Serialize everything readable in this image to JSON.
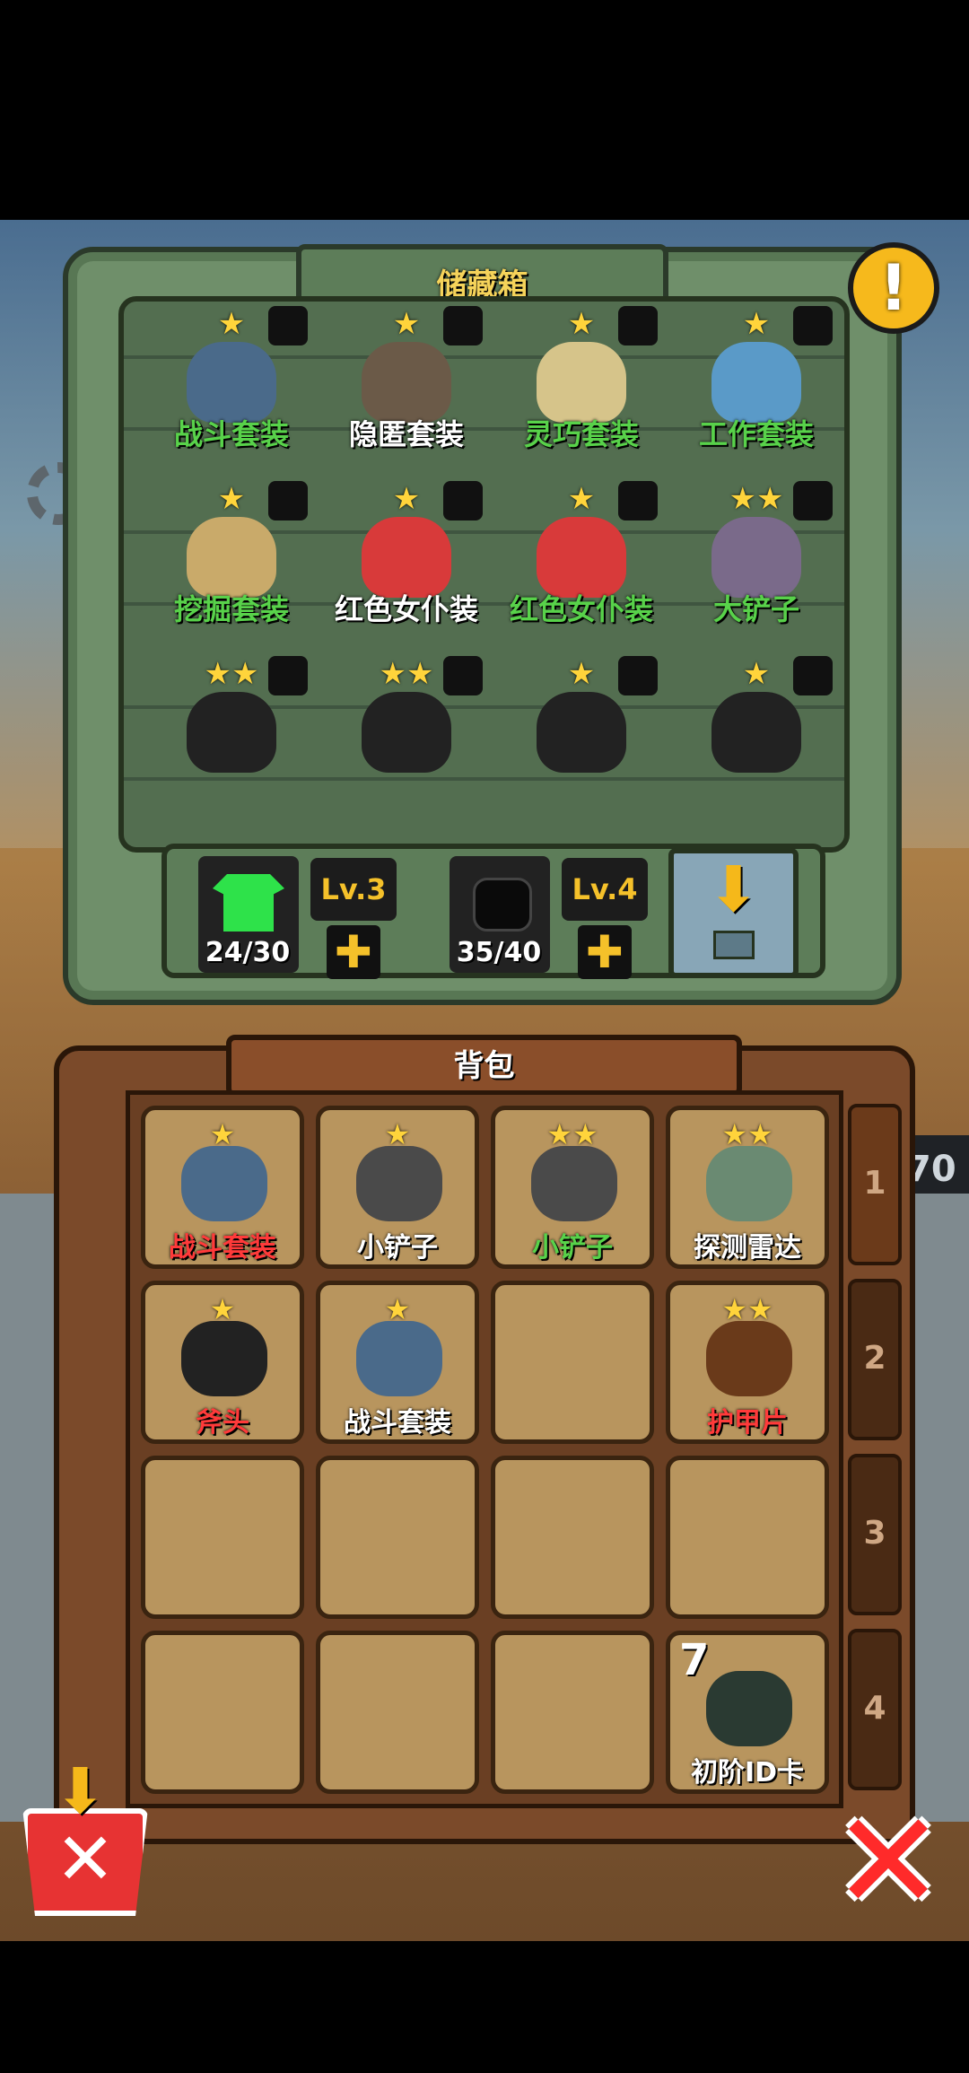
{
  "storage": {
    "title": "储藏箱",
    "alert_icon": "!",
    "items": [
      {
        "label": "战斗套装",
        "stars": "★",
        "color": "green",
        "icon": "combat-suit-icon",
        "tint": "#4a6a8a"
      },
      {
        "label": "隐匿套装",
        "stars": "★",
        "color": "white",
        "icon": "stealth-suit-icon",
        "tint": "#6b5a48"
      },
      {
        "label": "灵巧套装",
        "stars": "★",
        "color": "green",
        "icon": "agile-suit-icon",
        "tint": "#d6c48a"
      },
      {
        "label": "工作套装",
        "stars": "★",
        "color": "green",
        "icon": "work-suit-icon",
        "tint": "#5a9ac8"
      },
      {
        "label": "挖掘套装",
        "stars": "★",
        "color": "green",
        "icon": "digging-suit-icon",
        "tint": "#c9aa6a"
      },
      {
        "label": "红色女仆装",
        "stars": "★",
        "color": "white",
        "icon": "red-maid-outfit-icon",
        "tint": "#d83a3a"
      },
      {
        "label": "红色女仆装",
        "stars": "★",
        "color": "green",
        "icon": "red-maid-outfit-icon",
        "tint": "#d83a3a"
      },
      {
        "label": "大铲子",
        "stars": "★★",
        "color": "green",
        "icon": "big-shovel-icon",
        "tint": "#7a6a8a"
      },
      {
        "label": "",
        "stars": "★★",
        "color": "white",
        "icon": "slingshot-icon",
        "tint": "#222"
      },
      {
        "label": "",
        "stars": "★★",
        "color": "white",
        "icon": "slingshot-icon",
        "tint": "#222"
      },
      {
        "label": "",
        "stars": "★",
        "color": "white",
        "icon": "pistol-icon",
        "tint": "#222"
      },
      {
        "label": "",
        "stars": "★",
        "color": "white",
        "icon": "rocket-launcher-icon",
        "tint": "#222"
      }
    ],
    "outfit_capacity": "24/30",
    "outfit_level": "Lv.3",
    "bag_capacity": "35/40",
    "bag_level": "Lv.4",
    "plus_label": "✚",
    "store_arrow": "⬇"
  },
  "backpack": {
    "title": "背包",
    "cells": [
      {
        "label": "战斗套装",
        "stars": "★",
        "color": "red",
        "icon": "combat-suit-icon",
        "tint": "#4a6a8a",
        "qty": ""
      },
      {
        "label": "小铲子",
        "stars": "★",
        "color": "white",
        "icon": "small-shovel-icon",
        "tint": "#4a4a4a",
        "qty": ""
      },
      {
        "label": "小铲子",
        "stars": "★★",
        "color": "green",
        "icon": "small-shovel-icon",
        "tint": "#4a4a4a",
        "qty": ""
      },
      {
        "label": "探测雷达",
        "stars": "★★",
        "color": "white",
        "icon": "radar-detector-icon",
        "tint": "#6a8a72",
        "qty": ""
      },
      {
        "label": "斧头",
        "stars": "★",
        "color": "red",
        "icon": "axe-icon",
        "tint": "#222",
        "qty": ""
      },
      {
        "label": "战斗套装",
        "stars": "★",
        "color": "white",
        "icon": "combat-suit-icon",
        "tint": "#4a6a8a",
        "qty": ""
      },
      {
        "label": "",
        "stars": "",
        "color": "white",
        "icon": "",
        "tint": "transparent",
        "qty": ""
      },
      {
        "label": "护甲片",
        "stars": "★★",
        "color": "red",
        "icon": "armor-plate-icon",
        "tint": "#6a3a1a",
        "qty": ""
      },
      {
        "label": "",
        "stars": "",
        "color": "white",
        "icon": "",
        "tint": "transparent",
        "qty": ""
      },
      {
        "label": "",
        "stars": "",
        "color": "white",
        "icon": "",
        "tint": "transparent",
        "qty": ""
      },
      {
        "label": "",
        "stars": "",
        "color": "white",
        "icon": "",
        "tint": "transparent",
        "qty": ""
      },
      {
        "label": "",
        "stars": "",
        "color": "white",
        "icon": "",
        "tint": "transparent",
        "qty": ""
      },
      {
        "label": "",
        "stars": "",
        "color": "white",
        "icon": "",
        "tint": "transparent",
        "qty": ""
      },
      {
        "label": "",
        "stars": "",
        "color": "white",
        "icon": "",
        "tint": "transparent",
        "qty": ""
      },
      {
        "label": "",
        "stars": "",
        "color": "white",
        "icon": "",
        "tint": "transparent",
        "qty": ""
      },
      {
        "label": "初阶ID卡",
        "stars": "",
        "color": "white",
        "icon": "id-card-icon",
        "tint": "#2a3a32",
        "qty": "7"
      }
    ],
    "pages": [
      "1",
      "2",
      "3",
      "4"
    ]
  },
  "background": {
    "side_number": "70"
  },
  "actions": {
    "discard_arrow": "⬇",
    "discard_x": "✕",
    "close": "✕"
  }
}
